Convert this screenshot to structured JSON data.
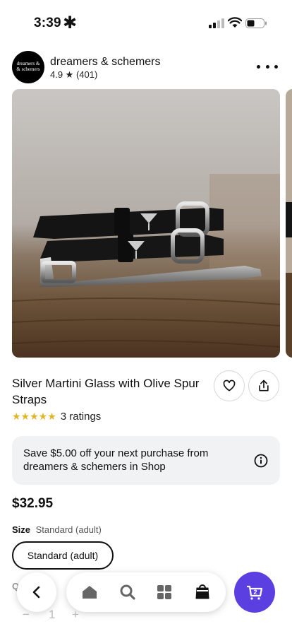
{
  "status_bar": {
    "time": "3:39",
    "extra_icon": "✱"
  },
  "shop": {
    "name": "dreamers & schemers",
    "rating": "4.9 ★ (401)",
    "logo_line1": "dreamers &",
    "logo_line2": "& schemers"
  },
  "product": {
    "title": "Silver Martini Glass with Olive Spur Straps",
    "stars": "★★★★★",
    "ratings": "3 ratings",
    "price": "$32.95"
  },
  "promo": {
    "text": "Save $5.00 off your next purchase from dreamers & schemers in Shop"
  },
  "size": {
    "label": "Size",
    "selected": "Standard (adult)",
    "option": "Standard (adult)"
  },
  "quantity": {
    "label": "Q",
    "value": "1",
    "minus": "−",
    "plus": "+"
  },
  "cart": {
    "count": "2"
  },
  "colors": {
    "accent": "#5c3fe0",
    "stars": "#e1b52b",
    "promo_bg": "#f1f2f4"
  },
  "icons": [
    "shield-check-icon",
    "signal-icon",
    "wifi-icon",
    "battery-icon",
    "more-icon",
    "heart-icon",
    "share-icon",
    "info-icon",
    "chevron-left-icon",
    "home-icon",
    "search-icon",
    "grid-icon",
    "shop-bag-icon",
    "cart-icon"
  ]
}
